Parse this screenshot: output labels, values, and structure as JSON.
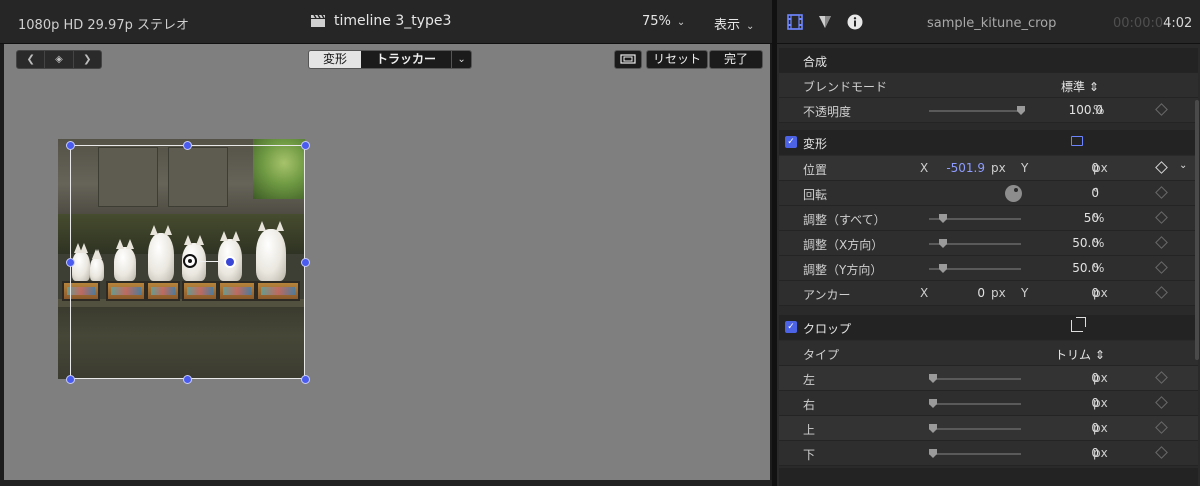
{
  "viewer": {
    "format": "1080p HD 29.97p ステレオ",
    "timeline_title": "timeline 3_type3",
    "zoom": "75%",
    "view_menu": "表示",
    "mode_transform": "変形",
    "mode_tracker": "トラッカー",
    "reset_label": "リセット",
    "done_label": "完了"
  },
  "inspector": {
    "clip_name": "sample_kitune_crop",
    "timecode_dim": "00:00:0",
    "timecode_bright": "4:02",
    "compositing": {
      "title": "合成",
      "blend_label": "ブレンドモード",
      "blend_value": "標準",
      "opacity_label": "不透明度",
      "opacity_value": "100.0",
      "opacity_unit": "%",
      "opacity_fraction": 1.0
    },
    "transform": {
      "title": "変形",
      "position_label": "位置",
      "x_axis": "X",
      "y_axis": "Y",
      "position_x": "-501.9",
      "position_y": "0",
      "px": "px",
      "rotation_label": "回転",
      "rotation_value": "0",
      "degree": "°",
      "scale_all_label": "調整（すべて）",
      "scale_all_value": "50",
      "scale_x_label": "調整（X方向）",
      "scale_x_value": "50.0",
      "scale_y_label": "調整（Y方向）",
      "scale_y_value": "50.0",
      "percent": "%",
      "anchor_label": "アンカー",
      "anchor_x": "0",
      "anchor_y": "0"
    },
    "crop": {
      "title": "クロップ",
      "type_label": "タイプ",
      "type_value": "トリム",
      "left_label": "左",
      "right_label": "右",
      "top_label": "上",
      "bottom_label": "下",
      "left_value": "0",
      "right_value": "0",
      "top_value": "0",
      "bottom_value": "0"
    }
  }
}
